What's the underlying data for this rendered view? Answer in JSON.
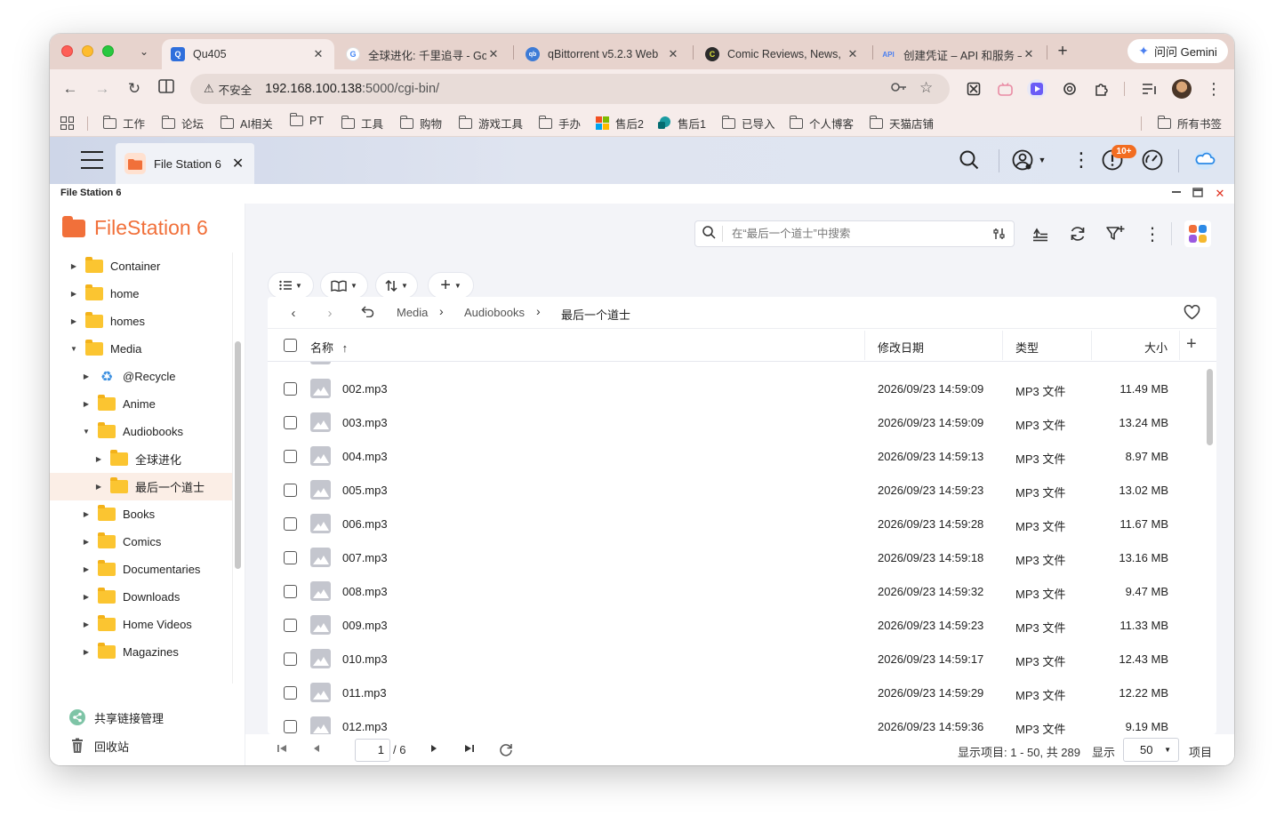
{
  "browser": {
    "tabs": [
      {
        "title": "Qu405",
        "favicon": "qnap-q",
        "active": true
      },
      {
        "title": "全球进化: 千里追寻 - Go",
        "favicon": "google-g",
        "active": false
      },
      {
        "title": "qBittorrent v5.2.3 Web",
        "favicon": "qbittorrent",
        "active": false
      },
      {
        "title": "Comic Reviews, News,",
        "favicon": "comicvine",
        "active": false
      },
      {
        "title": "创建凭证 – API 和服务 –",
        "favicon": "api",
        "active": false
      }
    ],
    "gemini_label": "问问 Gemini",
    "address": {
      "security_label": "不安全",
      "url_host": "192.168.100.138",
      "url_path": ":5000/cgi-bin/"
    },
    "bookmarks": [
      {
        "label": "工作",
        "type": "folder"
      },
      {
        "label": "论坛",
        "type": "folder"
      },
      {
        "label": "AI相关",
        "type": "folder"
      },
      {
        "label": "PT",
        "type": "folder"
      },
      {
        "label": "工具",
        "type": "folder"
      },
      {
        "label": "购物",
        "type": "folder"
      },
      {
        "label": "游戏工具",
        "type": "folder"
      },
      {
        "label": "手办",
        "type": "folder"
      },
      {
        "label": "售后2",
        "type": "link"
      },
      {
        "label": "售后1",
        "type": "link"
      },
      {
        "label": "已导入",
        "type": "folder"
      },
      {
        "label": "个人博客",
        "type": "folder"
      },
      {
        "label": "天猫店铺",
        "type": "folder"
      }
    ],
    "all_bookmarks": "所有书签"
  },
  "qts": {
    "open_app_tab": "File Station 6",
    "notification_badge": "10+"
  },
  "filestation": {
    "window_title": "File Station 6",
    "logo_text": "FileStation 6",
    "tree": [
      {
        "label": "Container",
        "level": 0,
        "expanded": false,
        "icon": "folder"
      },
      {
        "label": "home",
        "level": 0,
        "expanded": false,
        "icon": "folder"
      },
      {
        "label": "homes",
        "level": 0,
        "expanded": false,
        "icon": "folder"
      },
      {
        "label": "Media",
        "level": 0,
        "expanded": true,
        "icon": "folder"
      },
      {
        "label": "@Recycle",
        "level": 1,
        "expanded": false,
        "icon": "recycle"
      },
      {
        "label": "Anime",
        "level": 1,
        "expanded": false,
        "icon": "folder"
      },
      {
        "label": "Audiobooks",
        "level": 1,
        "expanded": true,
        "icon": "folder"
      },
      {
        "label": "全球进化",
        "level": 2,
        "expanded": false,
        "icon": "folder"
      },
      {
        "label": "最后一个道士",
        "level": 2,
        "expanded": false,
        "icon": "folder",
        "selected": true
      },
      {
        "label": "Books",
        "level": 1,
        "expanded": false,
        "icon": "folder"
      },
      {
        "label": "Comics",
        "level": 1,
        "expanded": false,
        "icon": "folder"
      },
      {
        "label": "Documentaries",
        "level": 1,
        "expanded": false,
        "icon": "folder"
      },
      {
        "label": "Downloads",
        "level": 1,
        "expanded": false,
        "icon": "folder"
      },
      {
        "label": "Home Videos",
        "level": 1,
        "expanded": false,
        "icon": "folder"
      },
      {
        "label": "Magazines",
        "level": 1,
        "expanded": false,
        "icon": "folder"
      }
    ],
    "sidebar_links": {
      "share_links": "共享链接管理",
      "recycle_bin": "回收站"
    },
    "search_placeholder": "在“最后一个道士”中搜索",
    "breadcrumb": [
      "Media",
      "Audiobooks",
      "最后一个道士"
    ],
    "columns": {
      "name": "名称",
      "modified": "修改日期",
      "type": "类型",
      "size": "大小"
    },
    "files": [
      {
        "name": "002.mp3",
        "modified": "2026/09/23 14:59:09",
        "type": "MP3 文件",
        "size": "11.49 MB"
      },
      {
        "name": "003.mp3",
        "modified": "2026/09/23 14:59:09",
        "type": "MP3 文件",
        "size": "13.24 MB"
      },
      {
        "name": "004.mp3",
        "modified": "2026/09/23 14:59:13",
        "type": "MP3 文件",
        "size": "8.97 MB"
      },
      {
        "name": "005.mp3",
        "modified": "2026/09/23 14:59:23",
        "type": "MP3 文件",
        "size": "13.02 MB"
      },
      {
        "name": "006.mp3",
        "modified": "2026/09/23 14:59:28",
        "type": "MP3 文件",
        "size": "11.67 MB"
      },
      {
        "name": "007.mp3",
        "modified": "2026/09/23 14:59:18",
        "type": "MP3 文件",
        "size": "13.16 MB"
      },
      {
        "name": "008.mp3",
        "modified": "2026/09/23 14:59:32",
        "type": "MP3 文件",
        "size": "9.47 MB"
      },
      {
        "name": "009.mp3",
        "modified": "2026/09/23 14:59:23",
        "type": "MP3 文件",
        "size": "11.33 MB"
      },
      {
        "name": "010.mp3",
        "modified": "2026/09/23 14:59:17",
        "type": "MP3 文件",
        "size": "12.43 MB"
      },
      {
        "name": "011.mp3",
        "modified": "2026/09/23 14:59:29",
        "type": "MP3 文件",
        "size": "12.22 MB"
      },
      {
        "name": "012.mp3",
        "modified": "2026/09/23 14:59:36",
        "type": "MP3 文件",
        "size": "9.19 MB"
      }
    ],
    "pager": {
      "current_page": "1",
      "total_pages": "/ 6",
      "range_info": "显示项目: 1 - 50, 共 289",
      "show_label": "显示",
      "page_size": "50",
      "items_label": "项目"
    }
  },
  "colors": {
    "accent_orange": "#f1703a",
    "folder_yellow": "#fbc531",
    "tab_strip": "#e7d3cd"
  }
}
